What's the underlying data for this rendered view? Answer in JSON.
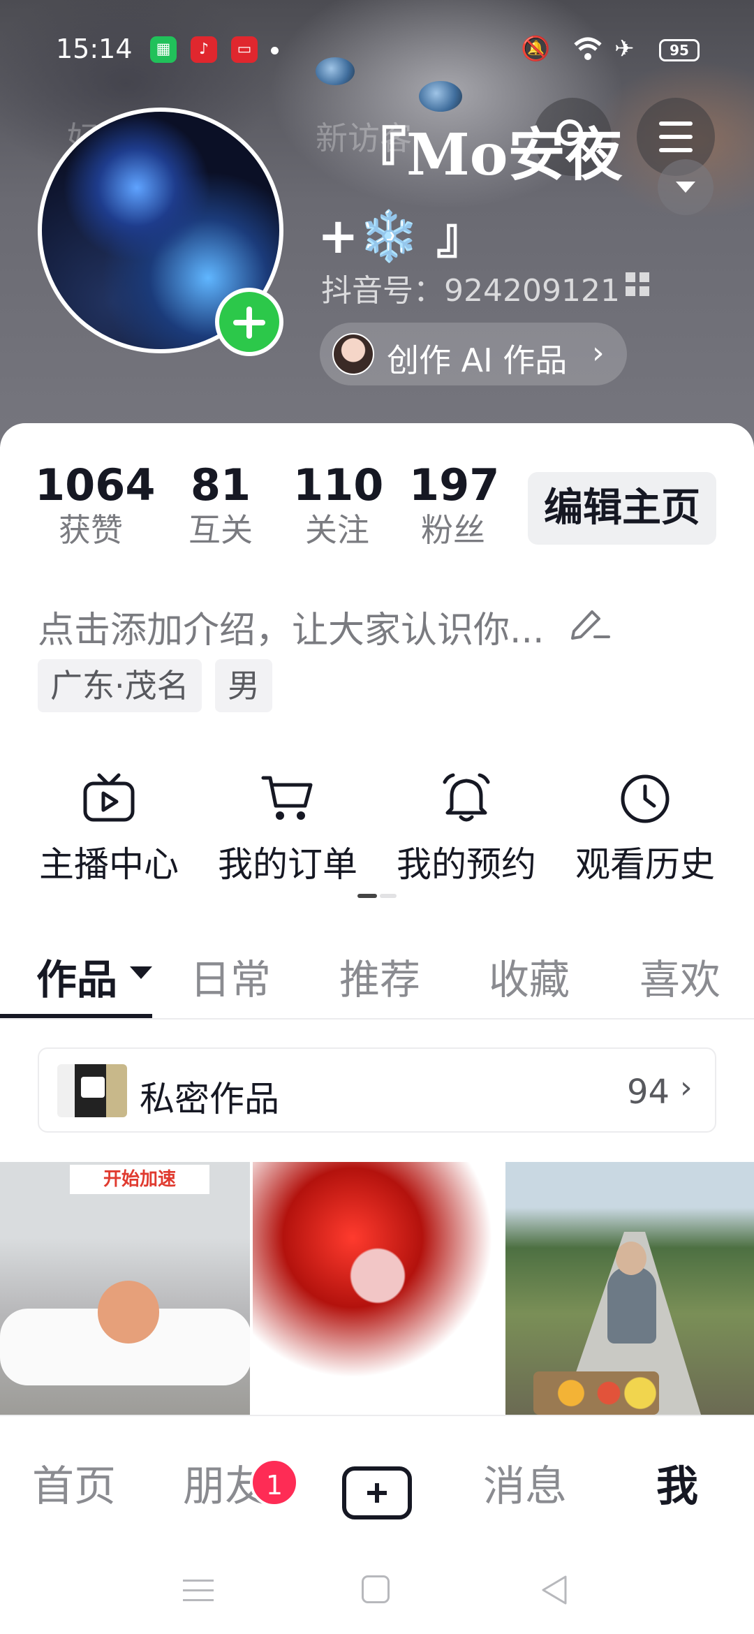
{
  "status_bar": {
    "time": "15:14",
    "battery": "95"
  },
  "header": {
    "ghost_left": "好友",
    "ghost_mid": "新访客",
    "nickname_line1": "『Mo安夜",
    "nickname_line2": "+❄️ 』",
    "douyin_id": "抖音号：924209121",
    "ai_pill_label": "创作 AI 作品",
    "ai_pill_chevron": "›"
  },
  "stats": [
    {
      "value": "1064",
      "label": "获赞"
    },
    {
      "value": "81",
      "label": "互关"
    },
    {
      "value": "110",
      "label": "关注"
    },
    {
      "value": "197",
      "label": "粉丝"
    }
  ],
  "edit_profile_label": "编辑主页",
  "bio_placeholder": "点击添加介绍，让大家认识你...",
  "tags": [
    "广东·茂名",
    "男"
  ],
  "quick_actions": [
    {
      "label": "主播中心",
      "icon": "tv-play-icon"
    },
    {
      "label": "我的订单",
      "icon": "cart-icon"
    },
    {
      "label": "我的预约",
      "icon": "bell-icon"
    },
    {
      "label": "观看历史",
      "icon": "clock-icon"
    }
  ],
  "content_tabs": [
    "作品",
    "日常",
    "推荐",
    "收藏",
    "喜欢"
  ],
  "private_works": {
    "label": "私密作品",
    "count": "94"
  },
  "grid": [
    {
      "banner": "开始加速"
    },
    {
      "banner": ""
    },
    {
      "banner": ""
    }
  ],
  "bottom_nav": {
    "home": "首页",
    "friends": "朋友",
    "friends_badge": "1",
    "messages": "消息",
    "me": "我"
  },
  "colors": {
    "accent_red": "#fe2c55",
    "add_green": "#2cc84a",
    "text_dark": "#161823",
    "text_gray": "#7a7b80"
  }
}
